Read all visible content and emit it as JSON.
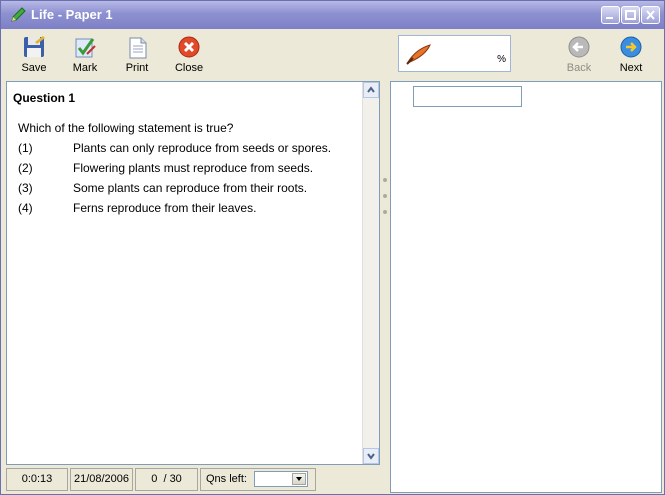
{
  "window": {
    "title": "Life - Paper 1"
  },
  "toolbar": {
    "save_label": "Save",
    "mark_label": "Mark",
    "print_label": "Print",
    "close_label": "Close",
    "back_label": "Back",
    "next_label": "Next"
  },
  "score": {
    "value": "",
    "unit": "%"
  },
  "question": {
    "heading": "Question 1",
    "text": "Which of the following statement is true?",
    "options": [
      {
        "num": "(1)",
        "text": "Plants can only reproduce from seeds or spores."
      },
      {
        "num": "(2)",
        "text": "Flowering plants must reproduce from seeds."
      },
      {
        "num": "(3)",
        "text": "Some plants can reproduce from their roots."
      },
      {
        "num": "(4)",
        "text": "Ferns reproduce from their leaves."
      }
    ]
  },
  "answer": {
    "value": ""
  },
  "status": {
    "timer": "0:0:13",
    "date": "21/08/2006",
    "answered": "0",
    "separator": "/",
    "total": "30",
    "qns_left_label": "Qns left:",
    "qns_left_value": ""
  },
  "colors": {
    "titlebar": "#8d90d0",
    "accent": "#e8732a"
  }
}
